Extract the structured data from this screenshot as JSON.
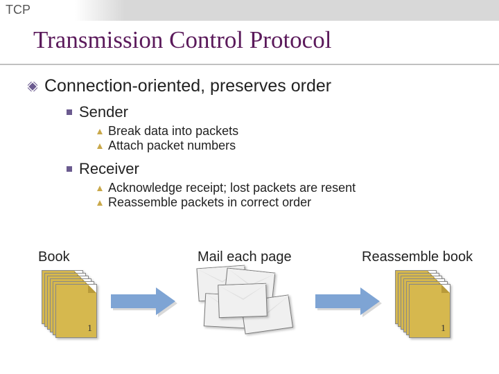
{
  "header": {
    "corner": "TCP"
  },
  "title": "Transmission Control Protocol",
  "bullet_main": "Connection-oriented, preserves order",
  "sender": {
    "label": "Sender",
    "items": [
      "Break data into packets",
      "Attach packet numbers"
    ]
  },
  "receiver": {
    "label": "Receiver",
    "items": [
      "Acknowledge receipt;  lost packets are resent",
      "Reassemble packets in correct order"
    ]
  },
  "diagram": {
    "left_label": "Book",
    "mid_label": "Mail each page",
    "right_label": "Reassemble book",
    "page_number": "1"
  }
}
